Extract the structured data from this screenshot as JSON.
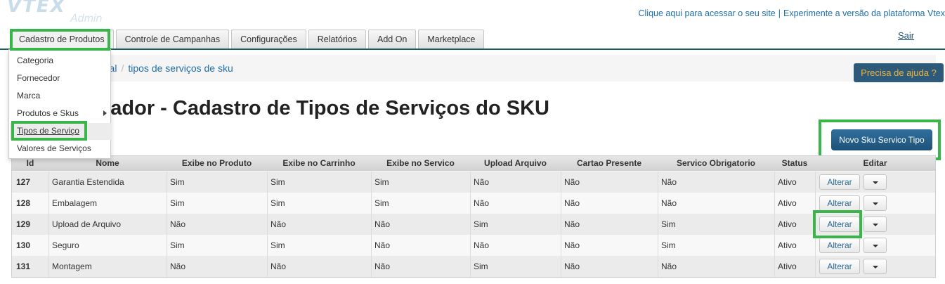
{
  "logo": {
    "main": "VTEX",
    "sub": "Admin"
  },
  "top_links": {
    "site": "Clique aqui para acessar o seu site",
    "separator": "|",
    "platform": "Experimente a versão da plataforma Vtex",
    "logout": "Sair"
  },
  "tabs": [
    "Cadastro de Produtos",
    "Controle de Campanhas",
    "Configurações",
    "Relatórios",
    "Add On",
    "Marketplace"
  ],
  "dropdown": {
    "items": [
      "Categoria",
      "Fornecedor",
      "Marca",
      "Produtos e Skus",
      "Tipos de Serviço",
      "Valores de Serviços"
    ],
    "active_item": "Tipos de Serviço"
  },
  "breadcrumb": {
    "parent": "ercial",
    "separator": "/",
    "current": "tipos de serviços de sku"
  },
  "help_button": "Precisa de ajuda ?",
  "page_title": "rador - Cadastro de Tipos de Serviços do SKU",
  "new_button": "Novo Sku Servico Tipo",
  "colors": {
    "accent": "#3ab54a",
    "link": "#1f6ea6",
    "help_bg": "#2d5a7b",
    "help_text": "#f0b43a",
    "tab_line": "#1a5c63"
  },
  "table": {
    "headers": [
      "Id",
      "Nome",
      "Exibe no Produto",
      "Exibe no Carrinho",
      "Exibe no Servico",
      "Upload Arquivo",
      "Cartao Presente",
      "Servico Obrigatorio",
      "Status",
      "Editar"
    ],
    "edit_label": "Alterar",
    "rows": [
      [
        "127",
        "Garantia Estendida",
        "Sim",
        "Sim",
        "Sim",
        "Não",
        "Não",
        "Não",
        "Ativo"
      ],
      [
        "128",
        "Embalagem",
        "Sim",
        "Sim",
        "Sim",
        "Não",
        "Não",
        "Não",
        "Ativo"
      ],
      [
        "129",
        "Upload de Arquivo",
        "Não",
        "Não",
        "Não",
        "Sim",
        "Não",
        "Sim",
        "Ativo"
      ],
      [
        "130",
        "Seguro",
        "Sim",
        "Sim",
        "Não",
        "Não",
        "Não",
        "Sim",
        "Ativo"
      ],
      [
        "131",
        "Montagem",
        "Não",
        "Não",
        "Não",
        "Sim",
        "Não",
        "Não",
        "Ativo"
      ]
    ]
  }
}
